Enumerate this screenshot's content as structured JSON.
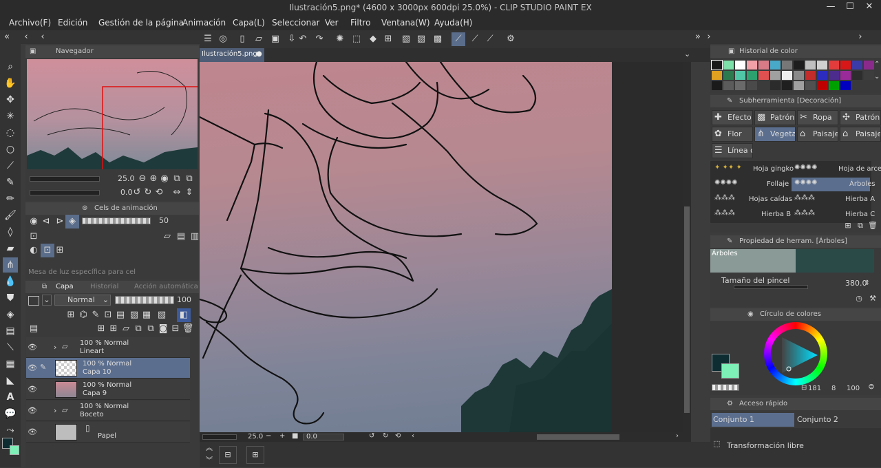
{
  "window": {
    "title": "Ilustración5.png* (4600 x 3000px 600dpi 25.0%) - CLIP STUDIO PAINT EX"
  },
  "menu": [
    "Archivo(F)",
    "Edición",
    "Gestión de la página",
    "Animación",
    "Capa(L)",
    "Seleccionar",
    "Ver",
    "Filtro",
    "Ventana(W)",
    "Ayuda(H)"
  ],
  "navigator": {
    "title": "Navegador",
    "zoom": "25.0",
    "angle": "0.0"
  },
  "animation": {
    "tab": "Cels de animación",
    "opacity": "50",
    "lighttable_placeholder": "Mesa de luz específica para cel"
  },
  "layers": {
    "tabs": [
      "Capa",
      "Historial",
      "Acción automática"
    ],
    "blend": "Normal",
    "opacity": "100",
    "items": [
      {
        "line1": "100 % Normal",
        "line2": "Lineart"
      },
      {
        "line1": "100 % Normal",
        "line2": "Capa 10"
      },
      {
        "line1": "100 % Normal",
        "line2": "Capa 9"
      },
      {
        "line1": "100 % Normal",
        "line2": "Boceto"
      },
      {
        "line1": "",
        "line2": "Papel"
      }
    ]
  },
  "document": {
    "tab": "Ilustración5.png*",
    "zoom": "25.0",
    "angle": "0.0"
  },
  "color_history": {
    "title": "Historial de color",
    "colors": [
      "#1a1a1a",
      "#7de0a8",
      "#ffffff",
      "#f2a0a8",
      "#d97b86",
      "#49a9c9",
      "#777777",
      "#1d1d1d",
      "#bfbfbf",
      "#d0d0d0",
      "#e33c3c",
      "#d81818",
      "#3a3aa8",
      "#8a2a8a",
      "#e0a020",
      "#2e7a4f",
      "#50c8a8",
      "#2da070",
      "#e05050",
      "#a0a0a0",
      "#f0f0f0",
      "#8a8a8a",
      "#c42c2c",
      "#2c2cc0",
      "#4c2c8c",
      "#9a2a9a",
      "#2d2d2d",
      "#3d3d3d",
      "#1a1a1a",
      "#5b5b5b",
      "#6a6a6a",
      "#4a4a4a",
      "#3b3b3b",
      "#2b2b2b",
      "#1f1f1f",
      "#a0a0a0",
      "#505050",
      "#c00000",
      "#00a000",
      "#0000c0"
    ]
  },
  "subtool": {
    "title": "Subherramienta [Decoración]",
    "buttons": [
      "Efecto",
      "Patrón",
      "Ropa",
      "Patrón",
      "Flor",
      "Vegeta",
      "Paisaje",
      "Paisaje",
      "Línea c"
    ],
    "brushes": [
      "Hoja gingko",
      "Hoja de arce",
      "Follaje",
      "Árboles",
      "Hojas caídas",
      "Hierba A",
      "Hierba B",
      "Hierba C"
    ]
  },
  "tool_property": {
    "title": "Propiedad de herram. [Árboles]",
    "preview_label": "Árboles",
    "size_label": "Tamaño del pincel",
    "size_value": "380.0"
  },
  "color_circle": {
    "title": "Círculo de colores",
    "hue": "181",
    "sat": "8",
    "val": "100",
    "main_color": "#0e2d33",
    "sub_color": "#7cf0b6"
  },
  "quick_access": {
    "title": "Acceso rápido",
    "sets": [
      "Conjunto 1",
      "Conjunto 2"
    ],
    "item": "Transformación libre"
  }
}
